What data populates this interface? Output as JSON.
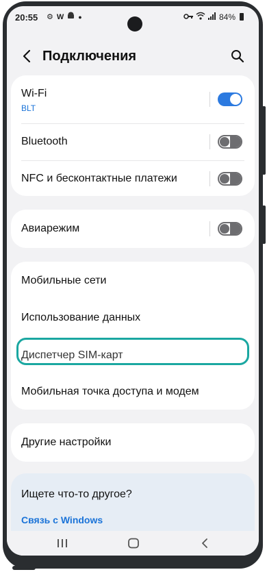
{
  "status_bar": {
    "time": "20:55",
    "left_icons": [
      "gear-icon",
      "w-icon",
      "android-icon",
      "dot-icon"
    ],
    "right_icons": [
      "key-icon",
      "wifi-icon",
      "signal-icon"
    ],
    "battery": "84%"
  },
  "header": {
    "title": "Подключения",
    "back_icon": "chevron-left-icon",
    "search_icon": "search-icon"
  },
  "group1": {
    "wifi": {
      "label": "Wi-Fi",
      "network": "BLT",
      "enabled": true
    },
    "bluetooth": {
      "label": "Bluetooth",
      "enabled": false
    },
    "nfc": {
      "label": "NFC и бесконтактные платежи",
      "enabled": false
    }
  },
  "group2": {
    "airplane": {
      "label": "Авиарежим",
      "enabled": false
    }
  },
  "group3": {
    "items": [
      "Мобильные сети",
      "Использование данных",
      "Диспетчер SIM-карт",
      "Мобильная точка доступа и модем"
    ]
  },
  "group4": {
    "items": [
      "Другие настройки"
    ]
  },
  "suggestions": {
    "title": "Ищете что-то другое?",
    "link": "Связь с Windows"
  },
  "colors": {
    "accent": "#2c7ae0",
    "highlight": "#1aa7a1",
    "link": "#1a73d8"
  }
}
